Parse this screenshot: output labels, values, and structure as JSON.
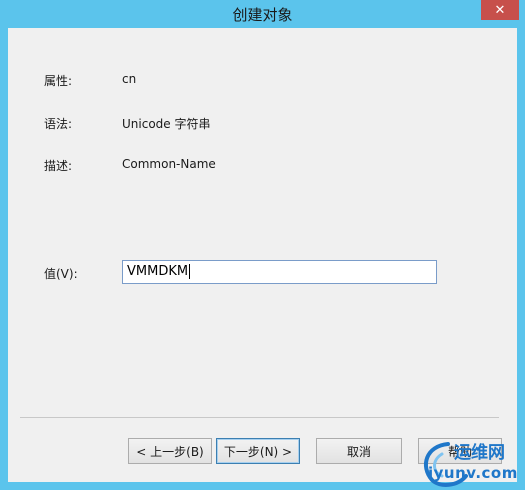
{
  "window": {
    "title": "创建对象",
    "close_glyph": "✕"
  },
  "attributes": [
    {
      "label": "属性:",
      "value": "cn"
    },
    {
      "label": "语法:",
      "value": "Unicode 字符串"
    },
    {
      "label": "描述:",
      "value": "Common-Name"
    }
  ],
  "value_field": {
    "label": "值(V):",
    "value": "VMMDKM"
  },
  "buttons": {
    "back": "< 上一步(B)",
    "next": "下一步(N) >",
    "cancel": "取消",
    "help": "帮助"
  },
  "watermark": {
    "top": "运维网",
    "bottom": "iyunv.com"
  },
  "colors": {
    "title_bar": "#5bc4ec",
    "close_button": "#c7504b",
    "input_border": "#7a9cc9",
    "watermark": "#1f77c9"
  }
}
